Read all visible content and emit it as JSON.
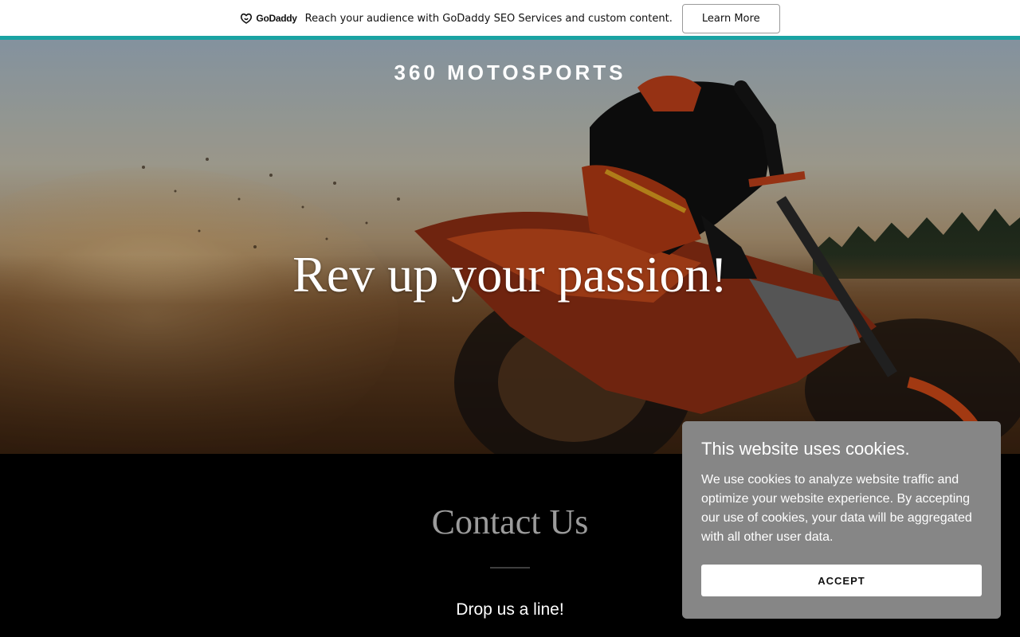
{
  "promo": {
    "logo_text": "GoDaddy",
    "message": "Reach your audience with GoDaddy SEO Services and custom content.",
    "button_label": "Learn More",
    "accent_color": "#1aa3a3"
  },
  "hero": {
    "site_title": "360 MOTOSPORTS",
    "headline": "Rev up your passion!",
    "image_subject": "motocross rider on dirt bike"
  },
  "contact": {
    "heading": "Contact Us",
    "subheading": "Drop us a line!"
  },
  "cookie_banner": {
    "title": "This website uses cookies.",
    "body": "We use cookies to analyze website traffic and optimize your website experience. By accepting our use of cookies, your data will be aggregated with all other user data.",
    "accept_label": "ACCEPT",
    "background_color": "#868686"
  }
}
